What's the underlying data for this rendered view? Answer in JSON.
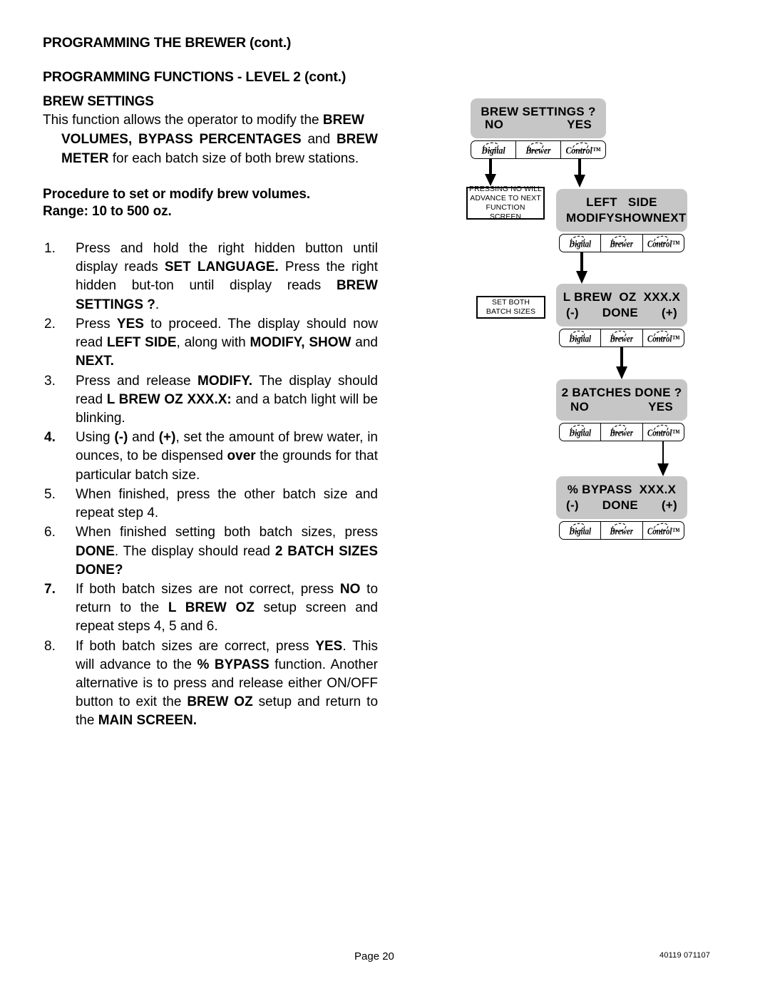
{
  "document": {
    "heading_1": "PROGRAMMING THE BREWER (cont.)",
    "heading_2": "PROGRAMMING FUNCTIONS - LEVEL  2 (cont.)",
    "section_title": "BREW SETTINGS"
  },
  "intro": {
    "line_1_plain_a": "This function allows the operator to modify the ",
    "line_1_bold_a": "BREW",
    "line_2_bold_a": "VOLUMES,  BYPASS  PERCENTAGES",
    "line_2_plain_a": " and ",
    "line_2_bold_b": "BREW",
    "line_3_bold_a": "METER",
    "line_3_plain_a": " for each batch size of both brew stations."
  },
  "procedure": {
    "title": "Procedure to set or modify brew volumes.",
    "range": "Range: 10 to 500 oz."
  },
  "steps": [
    {
      "number": "1.",
      "number_bold": false,
      "parts": [
        {
          "t": "Press and hold the right hidden button until display reads ",
          "b": false
        },
        {
          "t": "SET LANGUAGE.",
          "b": true
        },
        {
          "t": " Press the right hidden but-ton until display reads ",
          "b": false
        },
        {
          "t": "BREW SETTINGS ?",
          "b": true
        },
        {
          "t": ".",
          "b": false
        }
      ]
    },
    {
      "number": "2.",
      "number_bold": false,
      "parts": [
        {
          "t": "Press ",
          "b": false
        },
        {
          "t": "YES",
          "b": true
        },
        {
          "t": " to proceed. The display should now read  ",
          "b": false
        },
        {
          "t": "LEFT  SIDE",
          "b": true
        },
        {
          "t": ", along with ",
          "b": false
        },
        {
          "t": "MODIFY, SHOW",
          "b": true
        },
        {
          "t": " and ",
          "b": false
        },
        {
          "t": "NEXT.",
          "b": true
        }
      ]
    },
    {
      "number": "3.",
      "number_bold": false,
      "parts": [
        {
          "t": "Press and release ",
          "b": false
        },
        {
          "t": "MODIFY.",
          "b": true
        },
        {
          "t": " The display should read ",
          "b": false
        },
        {
          "t": "L  BREW OZ XXX.X:",
          "b": true
        },
        {
          "t": " and a batch light will be blinking.",
          "b": false
        }
      ]
    },
    {
      "number": "4.",
      "number_bold": true,
      "parts": [
        {
          "t": "Using ",
          "b": false
        },
        {
          "t": "(-)",
          "b": true
        },
        {
          "t": " and ",
          "b": false
        },
        {
          "t": "(+)",
          "b": true
        },
        {
          "t": ", set the amount of brew water, in ounces, to be dispensed ",
          "b": false
        },
        {
          "t": "over",
          "b": true
        },
        {
          "t": " the grounds for that particular batch size.",
          "b": false
        }
      ]
    },
    {
      "number": "5.",
      "number_bold": false,
      "parts": [
        {
          "t": "When finished, press the other batch size and repeat step 4.",
          "b": false
        }
      ]
    },
    {
      "number": "6.",
      "number_bold": false,
      "parts": [
        {
          "t": "When finished setting both batch sizes, press ",
          "b": false
        },
        {
          "t": "DONE",
          "b": true
        },
        {
          "t": ". The display should read ",
          "b": false
        },
        {
          "t": "2 BATCH SIZES DONE?",
          "b": true
        }
      ]
    },
    {
      "number": "7.",
      "number_bold": true,
      "parts": [
        {
          "t": "If both batch sizes are not correct, press ",
          "b": false
        },
        {
          "t": "NO",
          "b": true
        },
        {
          "t": " to return to the ",
          "b": false
        },
        {
          "t": "L  BREW OZ",
          "b": true
        },
        {
          "t": " setup screen and repeat steps 4, 5 and 6.",
          "b": false
        }
      ]
    },
    {
      "number": "8.",
      "number_bold": false,
      "parts": [
        {
          "t": "If both batch sizes are correct, press ",
          "b": false
        },
        {
          "t": "YES",
          "b": true
        },
        {
          "t": ". This will advance to the ",
          "b": false
        },
        {
          "t": "% BYPASS",
          "b": true
        },
        {
          "t": " function. Another alternative is to press and release either ON/OFF button to exit the ",
          "b": false
        },
        {
          "t": "BREW OZ",
          "b": true
        },
        {
          "t": " setup and return to the ",
          "b": false
        },
        {
          "t": "MAIN SCREEN.",
          "b": true
        }
      ]
    }
  ],
  "flowchart": {
    "button_bar": {
      "cell_1": "Digital",
      "cell_2": "Brewer",
      "cell_3": "Control™"
    },
    "screens": [
      {
        "id": "brew-settings-prompt",
        "line1": "BREW SETTINGS ?",
        "line2_left": "NO",
        "line2_right": "YES"
      },
      {
        "id": "left-side",
        "line1": "LEFT   SIDE",
        "line2_left": "MODIFY",
        "line2_mid": "SHOW",
        "line2_right": "NEXT"
      },
      {
        "id": "l-brew-oz",
        "line1": "L BREW  OZ  XXX.X",
        "line2_left": "(-)",
        "line2_mid": "DONE",
        "line2_right": "(+)"
      },
      {
        "id": "batches-done-prompt",
        "line1": "2 BATCHES DONE ?",
        "line2_left": "NO",
        "line2_right": "YES"
      },
      {
        "id": "percent-bypass",
        "line1": "% BYPASS  XXX.X",
        "line2_left": "(-)",
        "line2_mid": "DONE",
        "line2_right": "(+)"
      }
    ],
    "notes": [
      {
        "id": "pressing-no-note",
        "text": "PRESSING NO WILL\nADVANCE TO NEXT\nFUNCTION SCREEN"
      },
      {
        "id": "set-both-note",
        "text": "SET BOTH\nBATCH SIZES"
      }
    ]
  },
  "footer": {
    "page_label": "Page 20",
    "doc_code": "40119 071107"
  },
  "colors": {
    "lcd_gray": "#c6c6c6",
    "ink": "#000000",
    "paper": "#ffffff"
  }
}
